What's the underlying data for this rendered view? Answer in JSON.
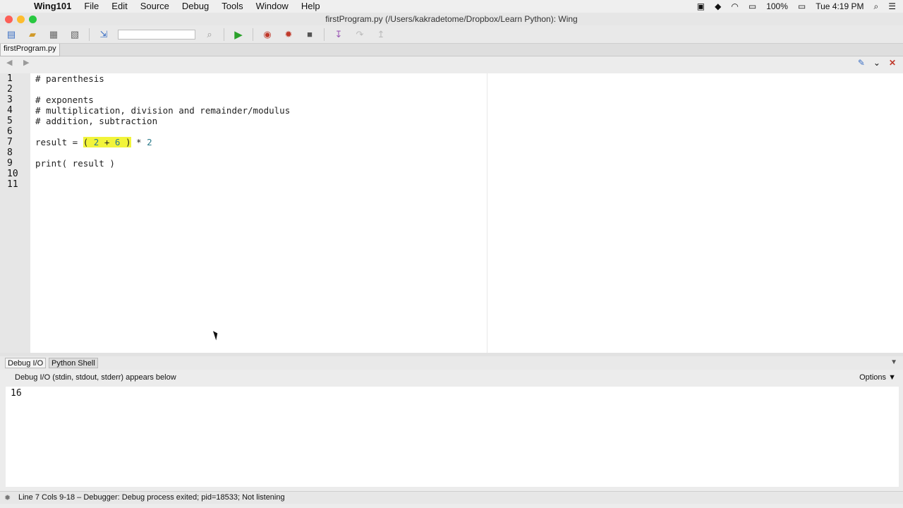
{
  "menubar": {
    "app_name": "Wing101",
    "items": [
      "File",
      "Edit",
      "Source",
      "Debug",
      "Tools",
      "Window",
      "Help"
    ],
    "battery": "100%",
    "clock": "Tue 4:19 PM"
  },
  "window": {
    "title": "firstProgram.py (/Users/kakradetome/Dropbox/Learn Python): Wing"
  },
  "file_tab": {
    "label": "firstProgram.py"
  },
  "editor": {
    "line_numbers": [
      "1",
      "2",
      "3",
      "4",
      "5",
      "6",
      "7",
      "8",
      "9",
      "10",
      "11"
    ],
    "lines": {
      "l1": "# parenthesis",
      "l3": "# exponents",
      "l4": "# multiplication, division and remainder/modulus",
      "l5": "# addition, subtraction",
      "l7_a": "result = ",
      "l7_b": "( ",
      "l7_c": "2",
      "l7_d": " + ",
      "l7_e": "6",
      "l7_f": " )",
      "l7_g": " * ",
      "l7_h": "2",
      "l9": "print( result )"
    }
  },
  "tools": {
    "tabs": [
      "Debug I/O",
      "Python Shell"
    ],
    "description": "Debug I/O (stdin, stdout, stderr) appears below",
    "options_label": "Options",
    "output": "16"
  },
  "status": {
    "message": "Line 7 Cols 9-18 – Debugger: Debug process exited; pid=18533; Not listening"
  },
  "colors": {
    "comment": "#2f8a2f",
    "number": "#2a7a8a",
    "highlight": "#f2f43a"
  }
}
